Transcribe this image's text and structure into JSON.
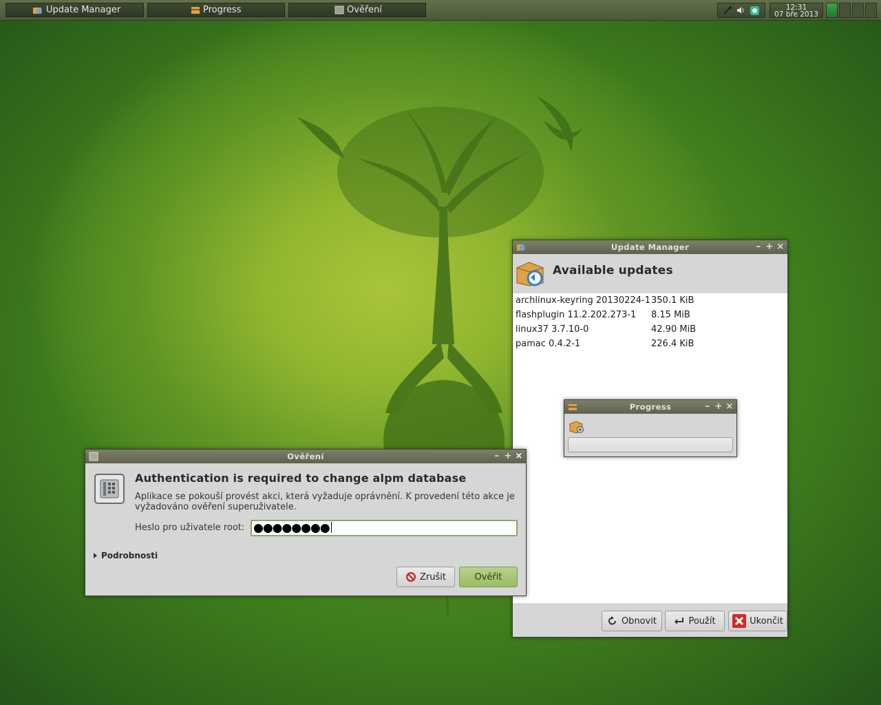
{
  "colors": {
    "panel": "#4a5a36",
    "accent_green": "#9bbd66",
    "title_bar": "#5f6250",
    "wallpaper_green": "#6fa52a"
  },
  "taskbar": {
    "tasks": [
      {
        "label": "Update Manager",
        "icon": "update-manager-icon"
      },
      {
        "label": "Progress",
        "icon": "package-icon"
      },
      {
        "label": "Ověření",
        "icon": "dialog-icon"
      }
    ],
    "tray_icons": [
      "network-icon",
      "volume-icon",
      "pamac-tray-icon"
    ],
    "clock": {
      "time": "12:31",
      "date": "07 bře 2013"
    },
    "workspaces": 4,
    "active_workspace": 1
  },
  "update_manager": {
    "title": "Update Manager",
    "header": "Available updates",
    "packages": [
      {
        "name": "archlinux-keyring 20130224-1",
        "size": "350.1 KiB"
      },
      {
        "name": "flashplugin 11.2.202.273-1",
        "size": "8.15 MiB"
      },
      {
        "name": "linux37 3.7.10-0",
        "size": "42.90 MiB"
      },
      {
        "name": "pamac 0.4.2-1",
        "size": "226.4 KiB"
      }
    ],
    "buttons": {
      "refresh": "Obnovit",
      "apply": "Použít",
      "quit": "Ukončit"
    }
  },
  "progress_window": {
    "title": "Progress",
    "progress_fraction": 0
  },
  "auth_dialog": {
    "title": "Ověření",
    "heading": "Authentication is required to change alpm database",
    "description": "Aplikace se pokouší provést akci, která vyžaduje oprávnění. K provedení této akce je vyžadováno ověření superuživatele.",
    "password_label": "Heslo pro uživatele root:",
    "password_value": "●●●●●●●●",
    "details_label": "Podrobnosti",
    "cancel_label": "Zrušit",
    "ok_label": "Ověřit"
  },
  "window_controls": {
    "minimize": "–",
    "maximize": "+",
    "close": "×"
  }
}
